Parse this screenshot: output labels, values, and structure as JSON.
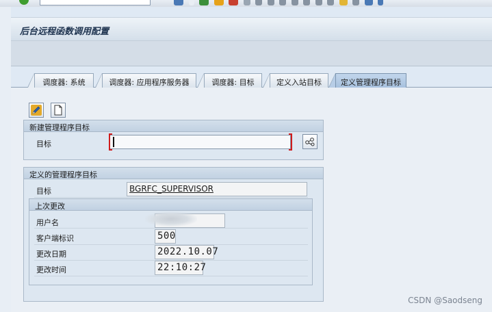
{
  "window": {
    "title": "后台远程函数调用配置"
  },
  "tabs": [
    {
      "label": "调度器: 系统",
      "active": false
    },
    {
      "label": "调度器: 应用程序服务器",
      "active": false
    },
    {
      "label": "调度器: 目标",
      "active": false
    },
    {
      "label": "定义入站目标",
      "active": false
    },
    {
      "label": "定义管理程序目标",
      "active": true
    }
  ],
  "toolbar": {
    "edit_icon": "pencil-icon",
    "new_icon": "blank-page-icon"
  },
  "new_destination_group": {
    "title": "新建管理程序目标",
    "target_label": "目标",
    "target_value": "",
    "search_icon": "destination-help-icon"
  },
  "defined_destination_group": {
    "title": "定义的管理程序目标",
    "target_label": "目标",
    "target_value": "BGRFC_SUPERVISOR",
    "last_change": {
      "title": "上次更改",
      "user_label": "用户名",
      "user_value": "",
      "client_label": "客户端标识",
      "client_value": "500",
      "date_label": "更改日期",
      "date_value": "2022.10.07",
      "time_label": "更改时间",
      "time_value": "22:10:27"
    }
  },
  "watermark": "CSDN @Saodseng",
  "colors": {
    "active_tab": "#b0c8e2",
    "group_background": "#dde7f1",
    "required_marker": "#d01c1c"
  }
}
